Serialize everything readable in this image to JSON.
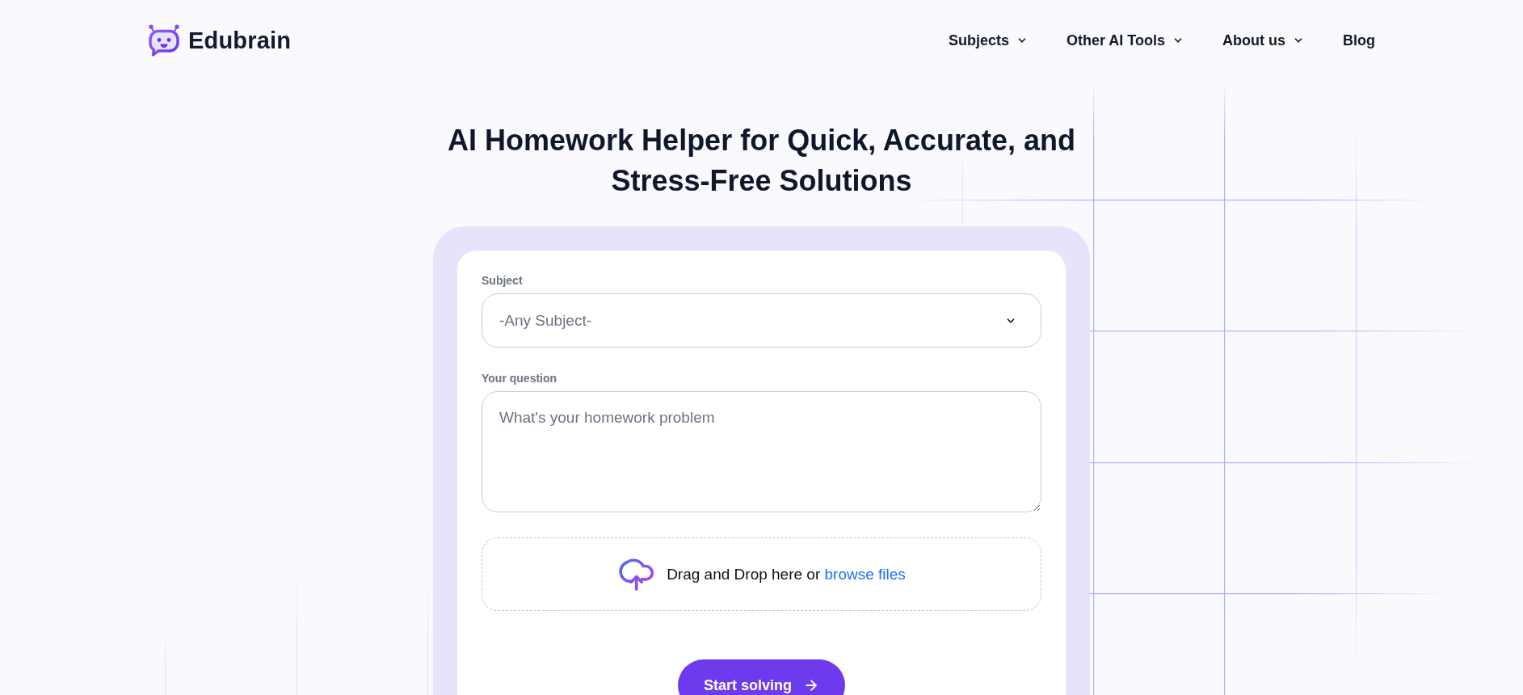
{
  "header": {
    "logo": {
      "name": "Edubrain"
    },
    "nav": [
      {
        "label": "Subjects",
        "kind": "dropdown"
      },
      {
        "label": "Other AI Tools",
        "kind": "dropdown"
      },
      {
        "label": "About us",
        "kind": "dropdown"
      },
      {
        "label": "Blog",
        "kind": "link"
      }
    ]
  },
  "hero": {
    "title": "AI Homework Helper for Quick, Accurate, and Stress-Free Solutions"
  },
  "form": {
    "subject": {
      "label": "Subject",
      "value": "-Any Subject-"
    },
    "question": {
      "label": "Your question",
      "placeholder": "What's your homework problem"
    },
    "upload": {
      "text": "Drag and Drop here or",
      "link": "browse files"
    },
    "submit": {
      "label": "Start solving"
    }
  }
}
